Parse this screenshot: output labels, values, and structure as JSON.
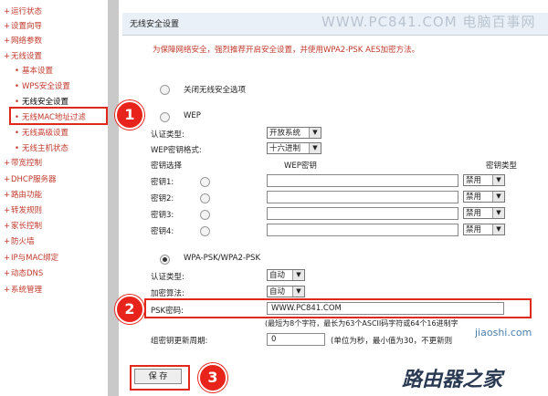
{
  "sidebar": {
    "items": [
      {
        "label": "运行状态",
        "sub": false
      },
      {
        "label": "设置向导",
        "sub": false
      },
      {
        "label": "网络参数",
        "sub": false
      },
      {
        "label": "无线设置",
        "sub": false
      },
      {
        "label": "基本设置",
        "sub": true
      },
      {
        "label": "WPS安全设置",
        "sub": true
      },
      {
        "label": "无线安全设置",
        "sub": true,
        "active": true
      },
      {
        "label": "无线MAC地址过滤",
        "sub": true
      },
      {
        "label": "无线高级设置",
        "sub": true
      },
      {
        "label": "无线主机状态",
        "sub": true
      },
      {
        "label": "带宽控制",
        "sub": false
      },
      {
        "label": "DHCP服务器",
        "sub": false
      },
      {
        "label": "路由功能",
        "sub": false
      },
      {
        "label": "转发规则",
        "sub": false
      },
      {
        "label": "家长控制",
        "sub": false
      },
      {
        "label": "防火墙",
        "sub": false
      },
      {
        "label": "IP与MAC绑定",
        "sub": false
      },
      {
        "label": "动态DNS",
        "sub": false
      },
      {
        "label": "系统管理",
        "sub": false
      }
    ]
  },
  "header": {
    "title": "无线安全设置",
    "watermark": "WWW.PC841.COM 电脑百事网"
  },
  "notice": "为保障网络安全，强烈推荐开启安全设置，并使用WPA2-PSK AES加密方法。",
  "options": {
    "disable_label": "关闭无线安全选项",
    "wep_label": "WEP",
    "wpa_label": "WPA-PSK/WPA2-PSK"
  },
  "wep": {
    "auth_label": "认证类型:",
    "auth_value": "开放系统",
    "format_label": "WEP密钥格式:",
    "format_value": "十六进制",
    "col_key_select": "密钥选择",
    "col_wep_key": "WEP密钥",
    "col_key_type": "密钥类型",
    "keys": [
      {
        "label": "密钥1:",
        "type": "禁用"
      },
      {
        "label": "密钥2:",
        "type": "禁用"
      },
      {
        "label": "密钥3:",
        "type": "禁用"
      },
      {
        "label": "密钥4:",
        "type": "禁用"
      }
    ]
  },
  "wpa": {
    "auth_label": "认证类型:",
    "auth_value": "自动",
    "algo_label": "加密算法:",
    "algo_value": "自动",
    "psk_label": "PSK密码:",
    "psk_value": "WWW.PC841.COM",
    "psk_hint": "(最短为8个字符，最长为63个ASCII码字符或64个16进制字",
    "renew_label": "组密钥更新周期:",
    "renew_value": "0",
    "renew_hint": "(单位为秒，最小值为30，不更新则"
  },
  "buttons": {
    "save": "保 存"
  },
  "badges": {
    "one": "1",
    "two": "2",
    "three": "3"
  },
  "footer_watermark": "路由器之家",
  "side_watermark": "jiaoshi.com"
}
